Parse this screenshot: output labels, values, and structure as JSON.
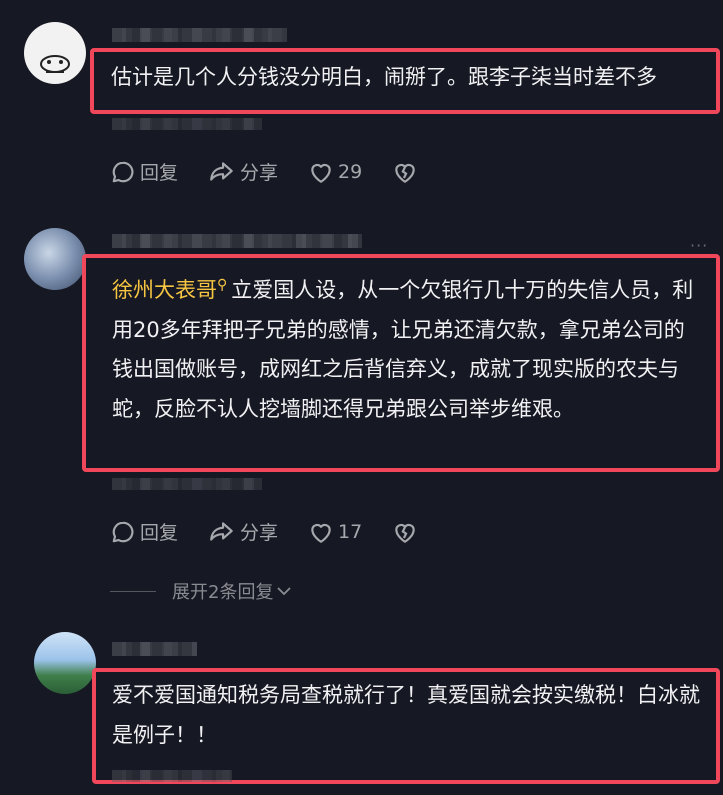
{
  "comments": [
    {
      "text": "估计是几个人分钱没分明白，闹掰了。跟李子柒当时差不多",
      "reply_label": "回复",
      "share_label": "分享",
      "likes": "29"
    },
    {
      "mention": "徐州大表哥",
      "text": "立爱国人设，从一个欠银行几十万的失信人员，利用20多年拜把子兄弟的感情，让兄弟还清欠款，拿兄弟公司的钱出国做账号，成网红之后背信弃义，成就了现实版的农夫与蛇，反脸不认人挖墙脚还得兄弟跟公司举步维艰。",
      "reply_label": "回复",
      "share_label": "分享",
      "likes": "17",
      "expand_label": "展开2条回复"
    },
    {
      "text": "爱不爱国通知税务局查税就行了！真爱国就会按实缴税！白冰就是例子！！"
    }
  ],
  "colors": {
    "background": "#161823",
    "highlight_border": "#f0485a",
    "mention": "#f6c542",
    "muted": "#a7a8ad"
  }
}
